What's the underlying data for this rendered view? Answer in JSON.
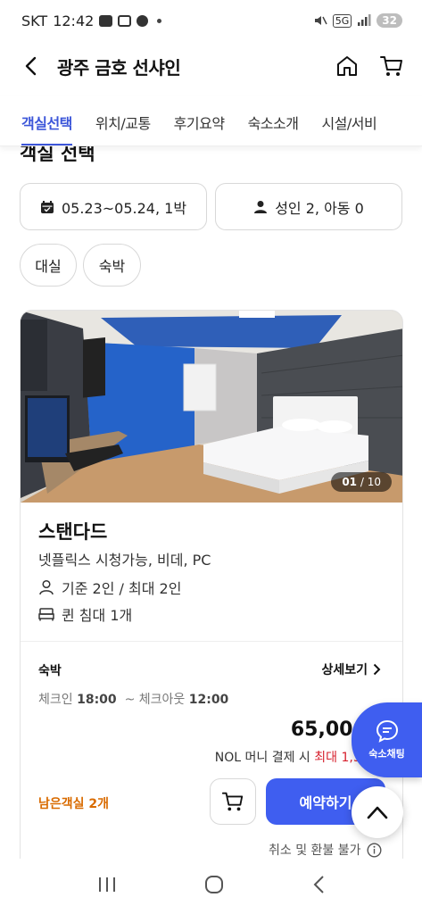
{
  "status_bar": {
    "carrier": "SKT",
    "time": "12:42",
    "network": "5G",
    "battery": "32"
  },
  "header": {
    "title": "광주 금호 선샤인"
  },
  "tabs": [
    {
      "label": "객실선택",
      "active": true
    },
    {
      "label": "위치/교통"
    },
    {
      "label": "후기요약"
    },
    {
      "label": "숙소소개"
    },
    {
      "label": "시설/서비"
    }
  ],
  "section": {
    "title": "객실 선택"
  },
  "filters": {
    "dates": "05.23~05.24, 1박",
    "guests": "성인 2, 아동 0",
    "chips": [
      "대실",
      "숙박"
    ]
  },
  "room": {
    "photo_counter": {
      "current": "01",
      "total": "/ 10"
    },
    "name": "스탠다드",
    "description": "넷플릭스 시청가능, 비데, PC",
    "capacity": "기준 2인 / 최대 2인",
    "bed": "퀸 침대 1개",
    "stay_label": "숙박",
    "detail_link": "상세보기",
    "checkin_label": "체크인",
    "checkin_time": "18:00",
    "checkout_label": "~ 체크아웃",
    "checkout_time": "12:00",
    "price": "65,000원",
    "nol_prefix": "NOL 머니 결제 시 ",
    "nol_highlight": "최대 1,300P",
    "remaining": "남은객실 2개",
    "reserve_label": "예약하기",
    "cancel_note": "취소 및 환불 불가"
  },
  "chat_fab": {
    "label": "숙소채팅"
  },
  "colors": {
    "accent": "#3f5ef0",
    "tab_active": "#3c56d9",
    "warning": "#d96b00",
    "highlight": "#d61f2c"
  },
  "icons": [
    "back-icon",
    "home-icon",
    "cart-icon",
    "calendar-icon",
    "person-icon",
    "bed-icon",
    "chevron-right-icon",
    "info-icon",
    "chat-icon",
    "arrow-up-icon"
  ]
}
